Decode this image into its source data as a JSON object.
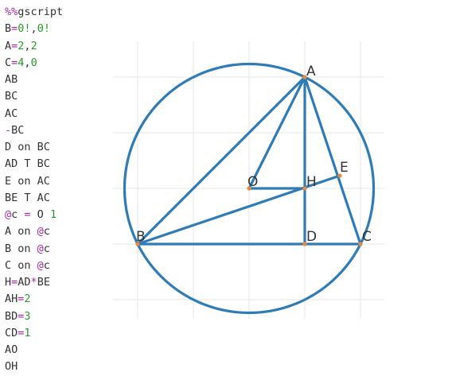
{
  "code": {
    "lines": [
      [
        {
          "t": "%%",
          "c": "magic"
        },
        {
          "t": "gscript",
          "c": "plain"
        }
      ],
      [
        {
          "t": "B",
          "c": "plain"
        },
        {
          "t": "=",
          "c": "op"
        },
        {
          "t": "0!",
          "c": "num"
        },
        {
          "t": ",",
          "c": "plain"
        },
        {
          "t": "0!",
          "c": "num"
        }
      ],
      [
        {
          "t": "A",
          "c": "plain"
        },
        {
          "t": "=",
          "c": "op"
        },
        {
          "t": "2",
          "c": "num"
        },
        {
          "t": ",",
          "c": "plain"
        },
        {
          "t": "2",
          "c": "num"
        }
      ],
      [
        {
          "t": "C",
          "c": "plain"
        },
        {
          "t": "=",
          "c": "op"
        },
        {
          "t": "4",
          "c": "num"
        },
        {
          "t": ",",
          "c": "plain"
        },
        {
          "t": "0",
          "c": "num"
        }
      ],
      [
        {
          "t": "AB",
          "c": "plain"
        }
      ],
      [
        {
          "t": "BC",
          "c": "plain"
        }
      ],
      [
        {
          "t": "AC",
          "c": "plain"
        }
      ],
      [
        {
          "t": "-",
          "c": "op"
        },
        {
          "t": "BC",
          "c": "plain"
        }
      ],
      [
        {
          "t": "D on BC",
          "c": "plain"
        }
      ],
      [
        {
          "t": "AD T BC",
          "c": "plain"
        }
      ],
      [
        {
          "t": "E on AC",
          "c": "plain"
        }
      ],
      [
        {
          "t": "BE T AC",
          "c": "plain"
        }
      ],
      [
        {
          "t": "@",
          "c": "magic"
        },
        {
          "t": "c ",
          "c": "plain"
        },
        {
          "t": "=",
          "c": "op"
        },
        {
          "t": " O ",
          "c": "plain"
        },
        {
          "t": "1",
          "c": "num"
        }
      ],
      [
        {
          "t": "A on ",
          "c": "plain"
        },
        {
          "t": "@",
          "c": "magic"
        },
        {
          "t": "c",
          "c": "plain"
        }
      ],
      [
        {
          "t": "B on ",
          "c": "plain"
        },
        {
          "t": "@",
          "c": "magic"
        },
        {
          "t": "c",
          "c": "plain"
        }
      ],
      [
        {
          "t": "C on ",
          "c": "plain"
        },
        {
          "t": "@",
          "c": "magic"
        },
        {
          "t": "c",
          "c": "plain"
        }
      ],
      [
        {
          "t": "H",
          "c": "plain"
        },
        {
          "t": "=",
          "c": "op"
        },
        {
          "t": "AD",
          "c": "plain"
        },
        {
          "t": "*",
          "c": "op"
        },
        {
          "t": "BE",
          "c": "plain"
        }
      ],
      [
        {
          "t": "AH",
          "c": "plain"
        },
        {
          "t": "=",
          "c": "op"
        },
        {
          "t": "2",
          "c": "num"
        }
      ],
      [
        {
          "t": "BD",
          "c": "plain"
        },
        {
          "t": "=",
          "c": "op"
        },
        {
          "t": "3",
          "c": "num"
        }
      ],
      [
        {
          "t": "CD",
          "c": "plain"
        },
        {
          "t": "=",
          "c": "op"
        },
        {
          "t": "1",
          "c": "num"
        }
      ],
      [
        {
          "t": "AO",
          "c": "plain"
        }
      ],
      [
        {
          "t": "OH",
          "c": "plain"
        }
      ]
    ],
    "colors": {
      "magic": "#a626a4",
      "op": "#a626a4",
      "num": "#2a9a2a",
      "plain": "#333333"
    }
  },
  "diagram": {
    "line_color": "#2e7bb6",
    "point_color": "#e8893a",
    "grid_color": "#e6e6e6",
    "points": [
      {
        "name": "A",
        "label": "A"
      },
      {
        "name": "B",
        "label": "B"
      },
      {
        "name": "C",
        "label": "C"
      },
      {
        "name": "D",
        "label": "D"
      },
      {
        "name": "E",
        "label": "E"
      },
      {
        "name": "O",
        "label": "O"
      },
      {
        "name": "H",
        "label": "H"
      }
    ],
    "segments": [
      [
        "A",
        "B"
      ],
      [
        "B",
        "C"
      ],
      [
        "A",
        "C"
      ],
      [
        "A",
        "D"
      ],
      [
        "B",
        "E"
      ],
      [
        "A",
        "O"
      ],
      [
        "O",
        "H"
      ]
    ],
    "circle": {
      "center": "O",
      "through": "A"
    }
  }
}
